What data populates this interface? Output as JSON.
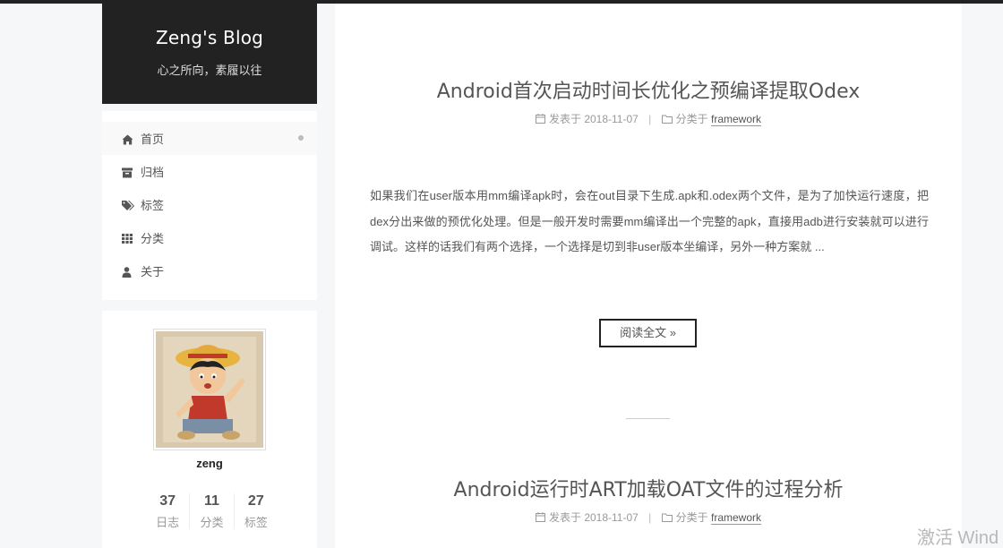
{
  "site": {
    "title": "Zeng's Blog",
    "subtitle": "心之所向，素履以往"
  },
  "menu": {
    "items": [
      {
        "label": "首页",
        "icon": "home-icon",
        "active": true
      },
      {
        "label": "归档",
        "icon": "archive-icon"
      },
      {
        "label": "标签",
        "icon": "tags-icon"
      },
      {
        "label": "分类",
        "icon": "th-icon"
      },
      {
        "label": "关于",
        "icon": "user-icon"
      }
    ]
  },
  "author": {
    "name": "zeng",
    "stats": [
      {
        "count": "37",
        "label": "日志"
      },
      {
        "count": "11",
        "label": "分类"
      },
      {
        "count": "27",
        "label": "标签"
      }
    ]
  },
  "posts": [
    {
      "title": "Android首次启动时间长优化之预编译提取Odex",
      "posted_label": "发表于",
      "date": "2018-11-07",
      "category_label": "分类于",
      "category": "framework",
      "excerpt": "如果我们在user版本用mm编译apk时，会在out目录下生成.apk和.odex两个文件，是为了加快运行速度，把dex分出来做的预优化处理。但是一般开发时需要mm编译出一个完整的apk，直接用adb进行安装就可以进行调试。这样的话我们有两个选择，一个选择是切到非user版本坐编译，另外一种方案就 ...",
      "read_more": "阅读全文 »"
    },
    {
      "title": "Android运行时ART加载OAT文件的过程分析",
      "posted_label": "发表于",
      "date": "2018-11-07",
      "category_label": "分类于",
      "category": "framework"
    }
  ],
  "overlay": {
    "watermark": "激活 Wind"
  },
  "colors": {
    "header_bg": "#222222",
    "page_bg": "#f5f7f9",
    "text": "#555555",
    "meta": "#999999"
  }
}
